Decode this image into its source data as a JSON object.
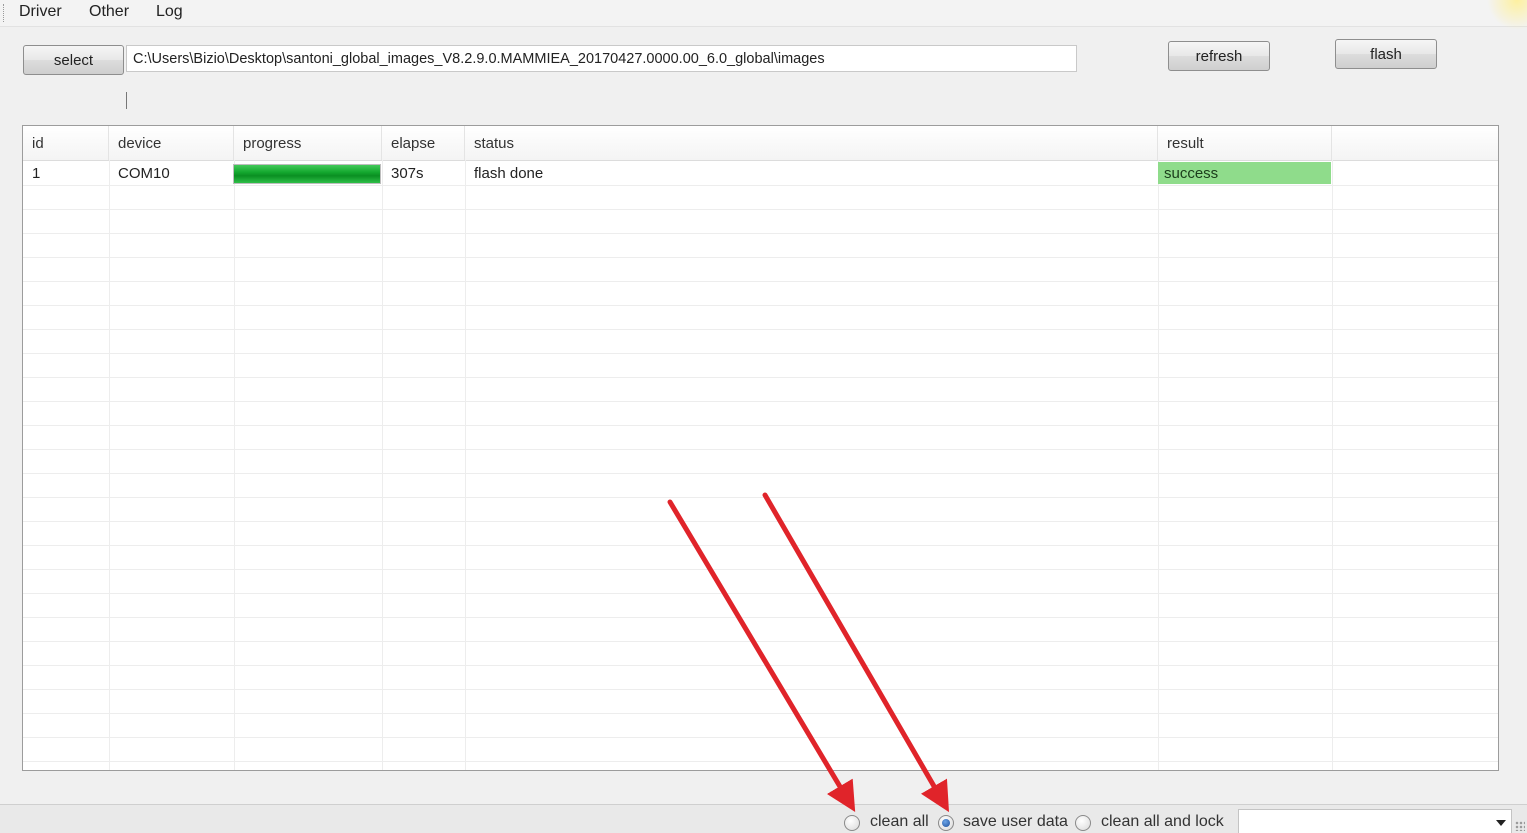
{
  "menu": {
    "items": [
      "Driver",
      "Other",
      "Log"
    ]
  },
  "toolbar": {
    "select_label": "select",
    "path_value": "C:\\Users\\Bizio\\Desktop\\santoni_global_images_V8.2.9.0.MAMMIEA_20170427.0000.00_6.0_global\\images",
    "refresh_label": "refresh",
    "flash_label": "flash"
  },
  "table": {
    "columns": [
      "id",
      "device",
      "progress",
      "elapse",
      "status",
      "result"
    ],
    "rows": [
      {
        "id": "1",
        "device": "COM10",
        "progress": 1.0,
        "elapse": "307s",
        "status": "flash done",
        "result": "success"
      }
    ]
  },
  "options": {
    "clean_all": "clean all",
    "save_user_data": "save user data",
    "clean_all_and_lock": "clean all and lock",
    "selected": "save_user_data"
  },
  "colors": {
    "success_bg": "#8fdc8b",
    "progress_green": "#14a82f",
    "annotation_arrow": "#e0242a"
  },
  "icons": {
    "combo_arrow": "chevron-down-icon",
    "annotation": "red-arrow-icon"
  }
}
